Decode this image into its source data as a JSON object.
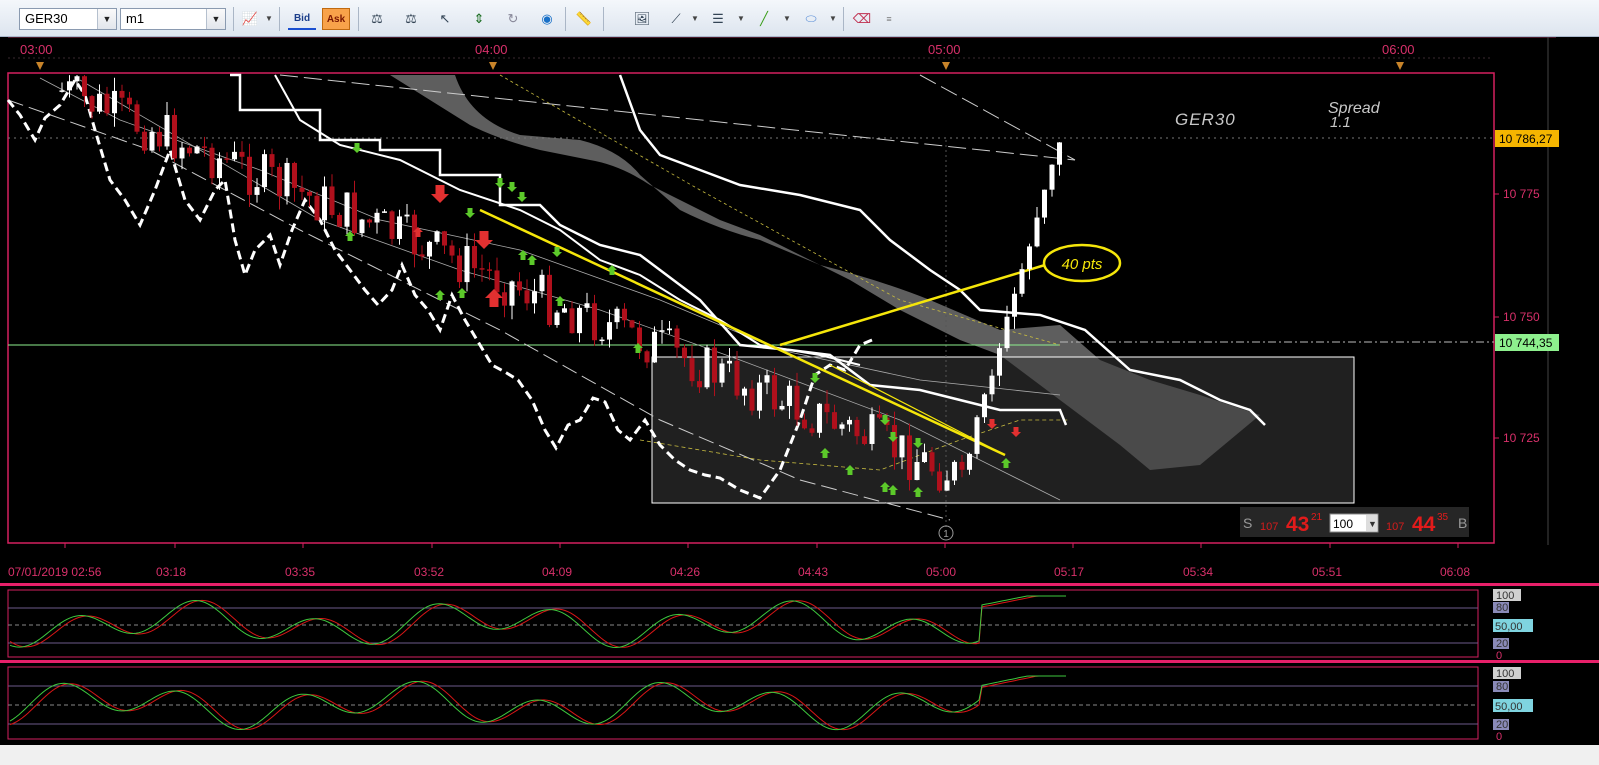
{
  "toolbar": {
    "symbol": "GER30",
    "timeframe": "m1",
    "bid_label": "Bid",
    "ask_label": "Ask"
  },
  "chart": {
    "symbol_label": "GER30",
    "spread_label": "Spread",
    "spread_value": "1.1",
    "annotation": "40 pts",
    "top_times": [
      "03:00",
      "04:00",
      "05:00",
      "06:00"
    ],
    "bottom_times": [
      "07/01/2019 02:56",
      "03:18",
      "03:35",
      "03:52",
      "04:09",
      "04:26",
      "04:43",
      "05:00",
      "05:17",
      "05:34",
      "05:51",
      "06:08"
    ],
    "price_labels": [
      "10 775",
      "10 750",
      "10 725"
    ],
    "price_tag_top": "10 786,27",
    "price_tag_current": "10 744,35",
    "marker_circle": "1",
    "trade_panel": {
      "sell_letter": "S",
      "sell_prefix": "107",
      "sell_big": "43",
      "sell_sup": "21",
      "quantity": "100",
      "buy_prefix": "107",
      "buy_big": "44",
      "buy_sup": "35",
      "buy_letter": "B"
    }
  },
  "oscillator1": {
    "levels": [
      "100",
      "80",
      "50,00",
      "20",
      "0"
    ]
  },
  "oscillator2": {
    "levels": [
      "100",
      "80",
      "50,00",
      "20",
      "0"
    ]
  },
  "colors": {
    "frame": "#d4205f",
    "candle_up": "#ffffff",
    "candle_down": "#b0101c",
    "trend_line": "#f5e60a",
    "current_price": "#8ef08e",
    "osc_red": "#d81616",
    "osc_green": "#3ec83e"
  }
}
